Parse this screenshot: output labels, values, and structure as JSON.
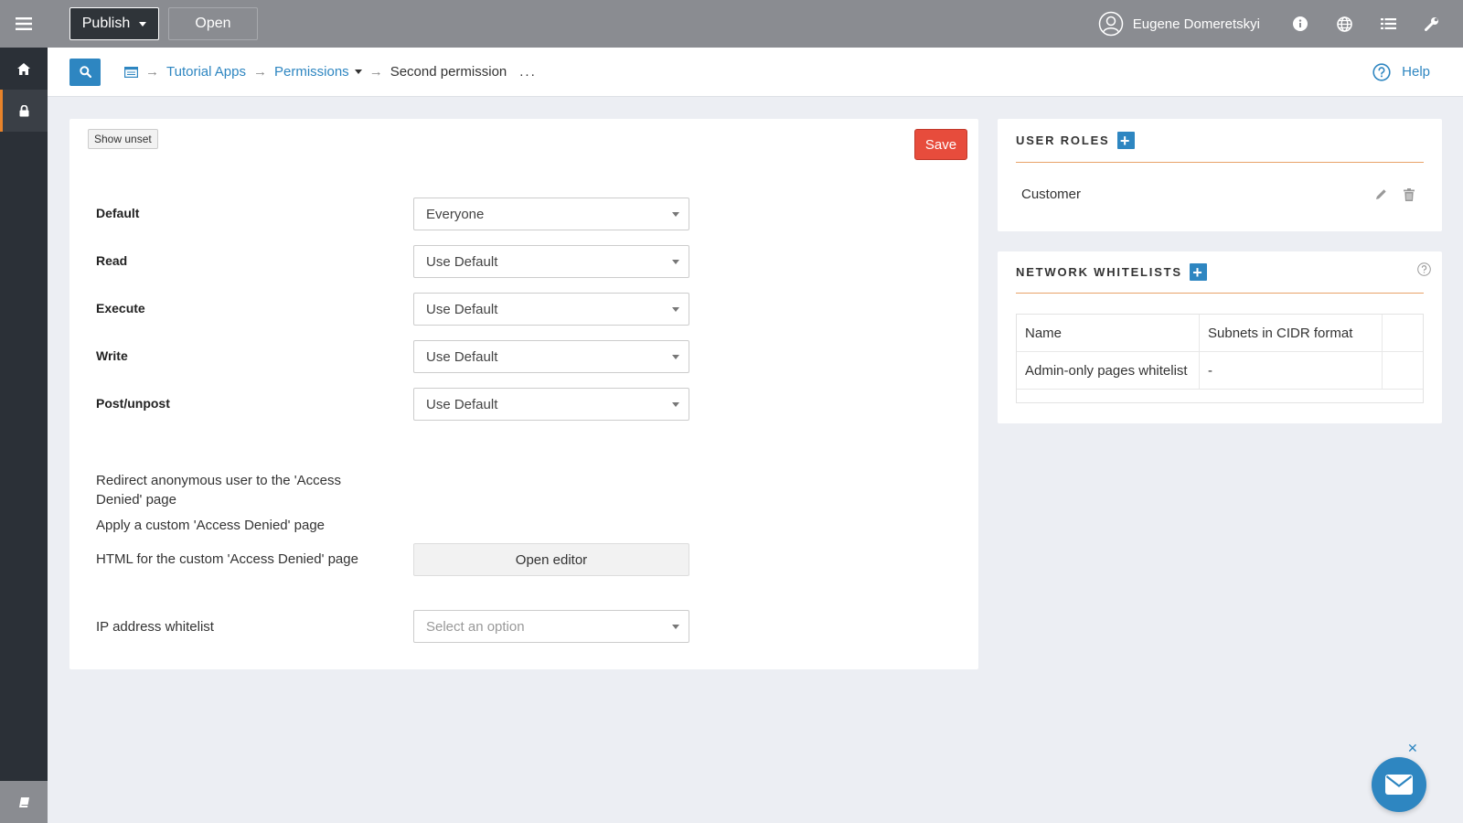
{
  "rail": {
    "items": [
      {
        "icon": "hamburger-icon"
      },
      {
        "icon": "home-icon"
      },
      {
        "icon": "lock-icon",
        "active": true
      }
    ],
    "bottom_icon": "book-icon"
  },
  "topbar": {
    "publish_label": "Publish",
    "open_label": "Open",
    "user_name": "Eugene Domeretskyi",
    "icons": [
      "info-icon",
      "globe-icon",
      "list-icon",
      "wrench-icon"
    ]
  },
  "breadcrumb": {
    "items": [
      "Tutorial Apps",
      "Permissions"
    ],
    "current": "Second permission",
    "more": "...",
    "help_label": "Help"
  },
  "form": {
    "show_unset_label": "Show unset",
    "save_label": "Save",
    "fields": [
      {
        "label": "Default",
        "value": "Everyone"
      },
      {
        "label": "Read",
        "value": "Use Default"
      },
      {
        "label": "Execute",
        "value": "Use Default"
      },
      {
        "label": "Write",
        "value": "Use Default"
      },
      {
        "label": "Post/unpost",
        "value": "Use Default"
      }
    ],
    "redirect_label": "Redirect anonymous user to the 'Access Denied' page",
    "custom_page_label": "Apply a custom 'Access Denied' page",
    "html_label": "HTML for the custom 'Access Denied' page",
    "open_editor_label": "Open editor",
    "ip_label": "IP address whitelist",
    "ip_placeholder": "Select an option"
  },
  "user_roles": {
    "title": "USER ROLES",
    "roles": [
      "Customer"
    ]
  },
  "network_whitelists": {
    "title": "NETWORK WHITELISTS",
    "columns": [
      "Name",
      "Subnets in CIDR format",
      ""
    ],
    "rows": [
      [
        "Admin-only pages whitelist",
        "-",
        ""
      ]
    ]
  },
  "colors": {
    "accent": "#2e86c1",
    "save": "#e74c3c",
    "active_rail": "#e8832a",
    "topbar": "#8a8c91"
  }
}
